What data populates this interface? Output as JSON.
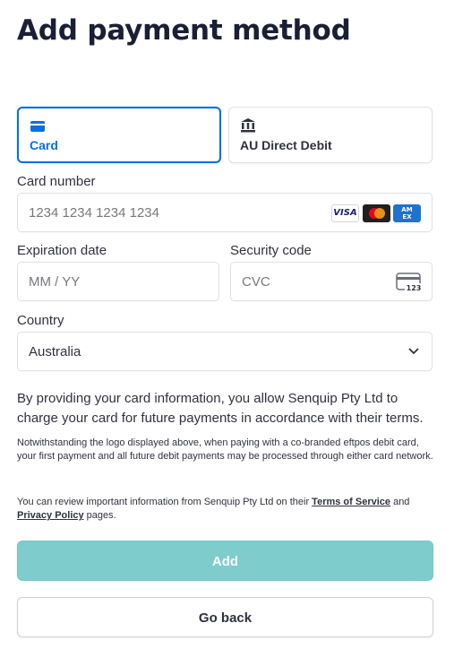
{
  "page": {
    "title": "Add payment method"
  },
  "tabs": [
    {
      "label": "Card",
      "icon": "card-icon",
      "active": true
    },
    {
      "label": "AU Direct Debit",
      "icon": "bank-icon",
      "active": false
    }
  ],
  "card_number": {
    "label": "Card number",
    "placeholder": "1234 1234 1234 1234",
    "brands": [
      "VISA",
      "Mastercard",
      "AMEX"
    ]
  },
  "expiration": {
    "label": "Expiration date",
    "placeholder": "MM / YY"
  },
  "security_code": {
    "label": "Security code",
    "placeholder": "CVC",
    "icon_text": "123"
  },
  "country": {
    "label": "Country",
    "value": "Australia"
  },
  "terms": {
    "main": "By providing your card information, you allow Senquip Pty Ltd to charge your card for future payments in accordance with their terms.",
    "eftpos": "Notwithstanding the logo displayed above, when paying with a co-branded eftpos debit card, your first payment and all future debit payments may be processed through either card network.",
    "review_prefix": "You can review important information from Senquip Pty Ltd on their ",
    "terms_link": "Terms of Service",
    "and": " and ",
    "privacy_link": "Privacy Policy",
    "review_suffix": " pages."
  },
  "buttons": {
    "add": "Add",
    "back": "Go back"
  },
  "colors": {
    "accent": "#0570de",
    "add_button": "#7fcccc"
  }
}
